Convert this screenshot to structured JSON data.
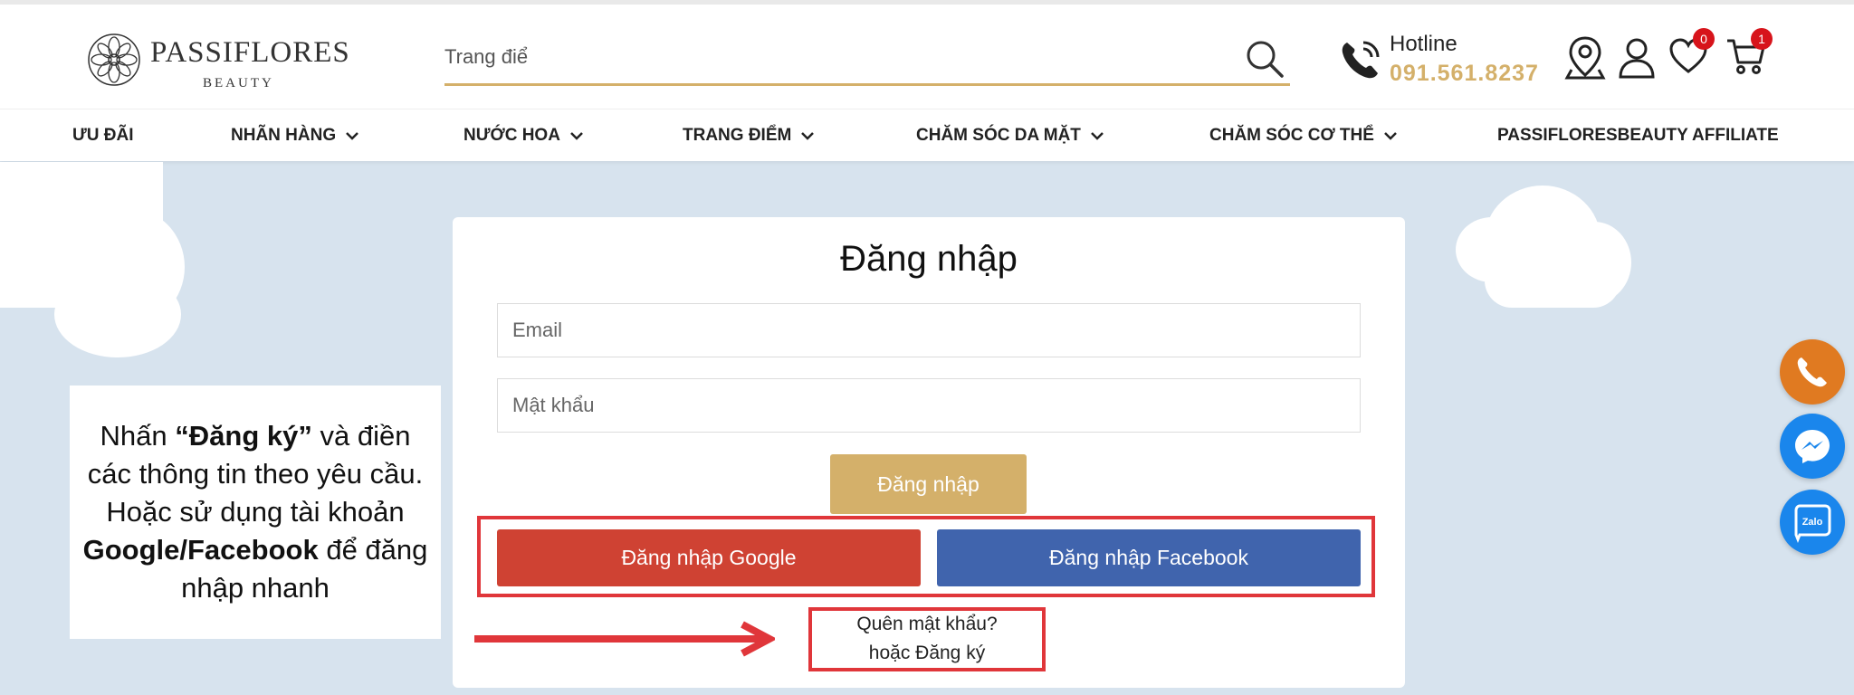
{
  "brand": {
    "name": "PASSIFLORES",
    "sub": "BEAUTY"
  },
  "search": {
    "placeholder": "Trang điể"
  },
  "hotline": {
    "label": "Hotline",
    "number": "091.561.8237"
  },
  "header_icons": {
    "wishlist_count": "0",
    "cart_count": "1"
  },
  "nav": {
    "items": [
      {
        "label": "ƯU ĐÃI",
        "has_dropdown": false
      },
      {
        "label": "NHÃN HÀNG",
        "has_dropdown": true
      },
      {
        "label": "NƯỚC HOA",
        "has_dropdown": true
      },
      {
        "label": "TRANG ĐIỂM",
        "has_dropdown": true
      },
      {
        "label": "CHĂM SÓC DA MẶT",
        "has_dropdown": true
      },
      {
        "label": "CHĂM SÓC CƠ THỂ",
        "has_dropdown": true
      },
      {
        "label": "PASSIFLORESBEAUTY AFFILIATE",
        "has_dropdown": false
      }
    ]
  },
  "instruction": {
    "part1": "Nhấn ",
    "bold1": "“Đăng ký”",
    "part2": " và điền các thông tin theo yêu cầu. Hoặc sử dụng tài khoản ",
    "bold2": "Google/Facebook",
    "part3": " để đăng nhập nhanh"
  },
  "login": {
    "title": "Đăng nhập",
    "email_placeholder": "Email",
    "password_placeholder": "Mật khẩu",
    "submit_label": "Đăng nhập",
    "google_label": "Đăng nhập Google",
    "facebook_label": "Đăng nhập Facebook",
    "forgot_label": "Quên mật khẩu?",
    "register_label": "hoặc Đăng ký"
  },
  "float_buttons": {
    "zalo_label": "Zalo"
  },
  "colors": {
    "accent_gold": "#d4b06a",
    "google_red": "#cf4233",
    "facebook_blue": "#4064ad",
    "highlight_red": "#e0363a",
    "background": "#d7e3ee"
  }
}
